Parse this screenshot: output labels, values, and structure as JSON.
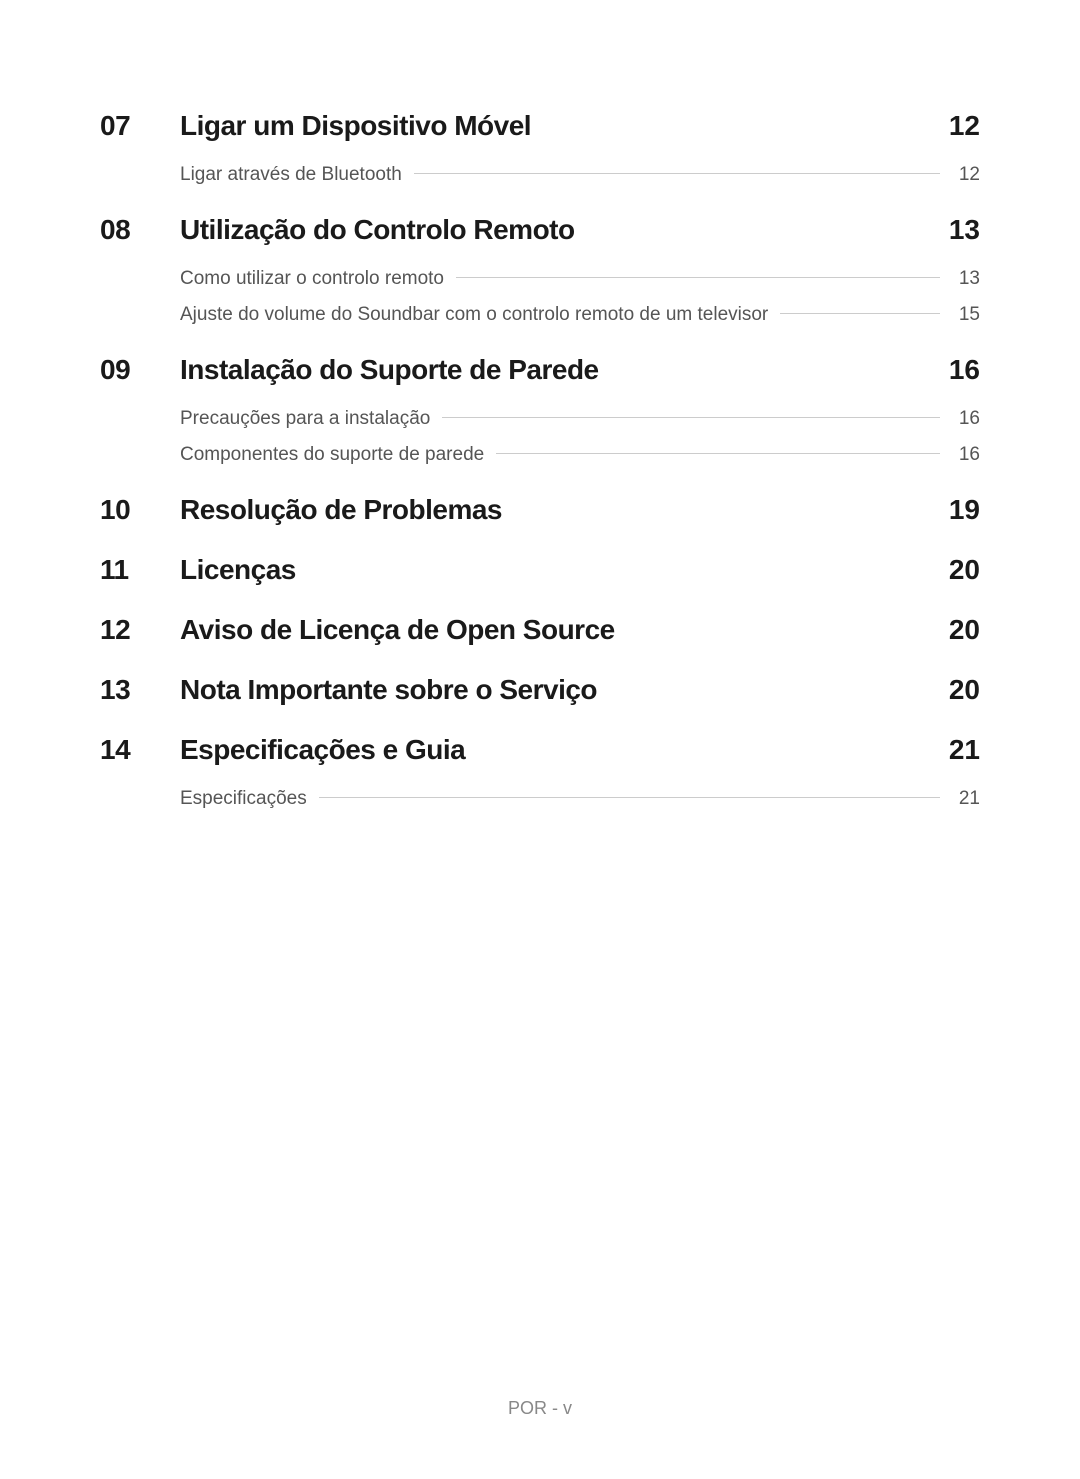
{
  "footer": "POR - v",
  "sections": [
    {
      "num": "07",
      "title": "Ligar um Dispositivo Móvel",
      "page": "12",
      "subs": [
        {
          "label": "Ligar através de Bluetooth",
          "page": "12"
        }
      ]
    },
    {
      "num": "08",
      "title": "Utilização do Controlo Remoto",
      "page": "13",
      "subs": [
        {
          "label": "Como utilizar o controlo remoto",
          "page": "13"
        },
        {
          "label": "Ajuste do volume do Soundbar com o controlo remoto de um televisor",
          "page": "15"
        }
      ]
    },
    {
      "num": "09",
      "title": "Instalação do Suporte de Parede",
      "page": "16",
      "subs": [
        {
          "label": "Precauções para a instalação",
          "page": "16"
        },
        {
          "label": "Componentes do suporte de parede",
          "page": "16"
        }
      ]
    },
    {
      "num": "10",
      "title": "Resolução de Problemas",
      "page": "19",
      "subs": []
    },
    {
      "num": "11",
      "title": "Licenças",
      "page": "20",
      "subs": []
    },
    {
      "num": "12",
      "title": "Aviso de Licença de Open Source",
      "page": "20",
      "subs": []
    },
    {
      "num": "13",
      "title": "Nota Importante sobre o Serviço",
      "page": "20",
      "subs": []
    },
    {
      "num": "14",
      "title": "Especificações e Guia",
      "page": "21",
      "subs": [
        {
          "label": "Especificações",
          "page": "21"
        }
      ]
    }
  ]
}
